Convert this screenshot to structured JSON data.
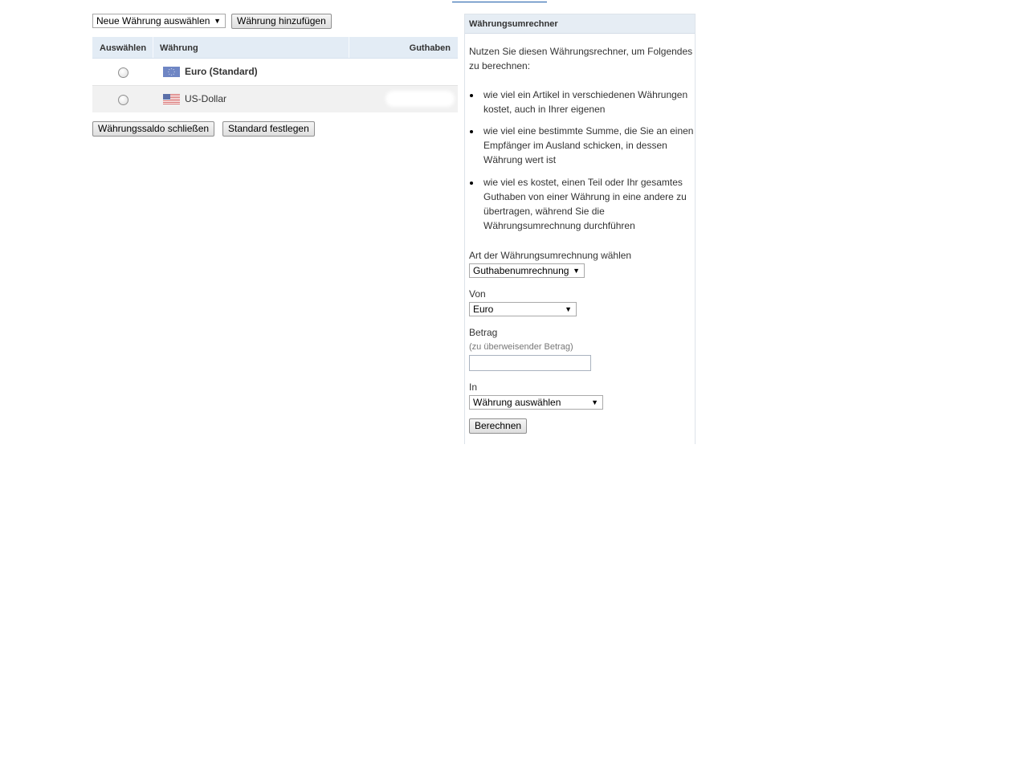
{
  "top_controls": {
    "new_currency_select": "Neue Währung auswählen",
    "add_currency_button": "Währung hinzufügen"
  },
  "currency_table": {
    "headers": {
      "select": "Auswählen",
      "currency": "Währung",
      "balance": "Guthaben"
    },
    "rows": [
      {
        "name": "Euro (Standard)",
        "flag": "eu-flag-icon"
      },
      {
        "name": "US-Dollar",
        "flag": "us-flag-icon"
      }
    ]
  },
  "bottom_buttons": {
    "close_balance": "Währungssaldo schließen",
    "set_default": "Standard festlegen"
  },
  "converter": {
    "title": "Währungsumrechner",
    "intro": "Nutzen Sie diesen Währungsrechner, um Folgendes zu berechnen:",
    "bullets": [
      "wie viel ein Artikel in verschiedenen Währungen kostet, auch in Ihrer eigenen",
      "wie viel eine bestimmte Summe, die Sie an einen Empfänger im Ausland schicken, in dessen Währung wert ist",
      "wie viel es kostet, einen Teil oder Ihr gesamtes Guthaben von einer Währung in eine andere zu übertragen, während Sie die Währungsumrechnung durchführen"
    ],
    "type_label": "Art der Währungsumrechnung wählen",
    "type_value": "Guthabenumrechnung",
    "from_label": "Von",
    "from_value": "Euro",
    "amount_label": "Betrag",
    "amount_hint": "(zu überweisender Betrag)",
    "amount_value": "",
    "to_label": "In",
    "to_value": "Währung auswählen",
    "calculate_button": "Berechnen"
  },
  "colors": {
    "header_bg": "#e3ecf5",
    "row_alt_bg": "#f1f1f1",
    "link": "#1a5aa8"
  }
}
